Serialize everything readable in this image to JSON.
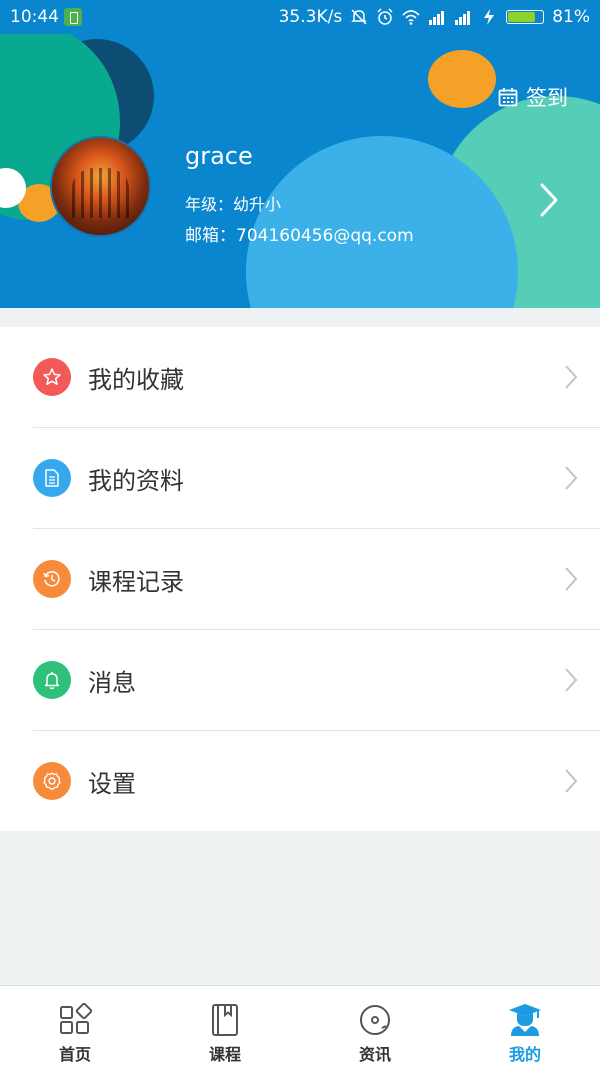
{
  "status_bar": {
    "time": "10:44",
    "net_speed": "35.3K/s",
    "battery_percent": "81%",
    "battery_level": 0.81
  },
  "header": {
    "checkin_label": "签到",
    "username": "grace",
    "grade_label": "年级：",
    "grade_value": "幼升小",
    "email_label": "邮箱：",
    "email_value": "704160456@qq.com",
    "colors": {
      "background": "#0a86cf",
      "bubble_green": "#08a98f",
      "bubble_dark": "#0e4d73",
      "bubble_orange": "#f5a128",
      "bubble_teal": "#55cdb7",
      "bubble_lightblue": "#3cb0e8"
    }
  },
  "menu": {
    "items": [
      {
        "label": "我的收藏",
        "icon": "star-icon",
        "color": "#f25a5a"
      },
      {
        "label": "我的资料",
        "icon": "document-icon",
        "color": "#37a7ee"
      },
      {
        "label": "课程记录",
        "icon": "history-icon",
        "color": "#f78b3b"
      },
      {
        "label": "消息",
        "icon": "bell-icon",
        "color": "#2fc07c"
      },
      {
        "label": "设置",
        "icon": "gear-icon",
        "color": "#f78b3b"
      }
    ]
  },
  "bottom_nav": {
    "items": [
      {
        "label": "首页",
        "icon": "home-grid-icon",
        "active": false
      },
      {
        "label": "课程",
        "icon": "book-icon",
        "active": false
      },
      {
        "label": "资讯",
        "icon": "disc-icon",
        "active": false
      },
      {
        "label": "我的",
        "icon": "graduate-icon",
        "active": true
      }
    ],
    "active_color": "#1a9be4"
  }
}
